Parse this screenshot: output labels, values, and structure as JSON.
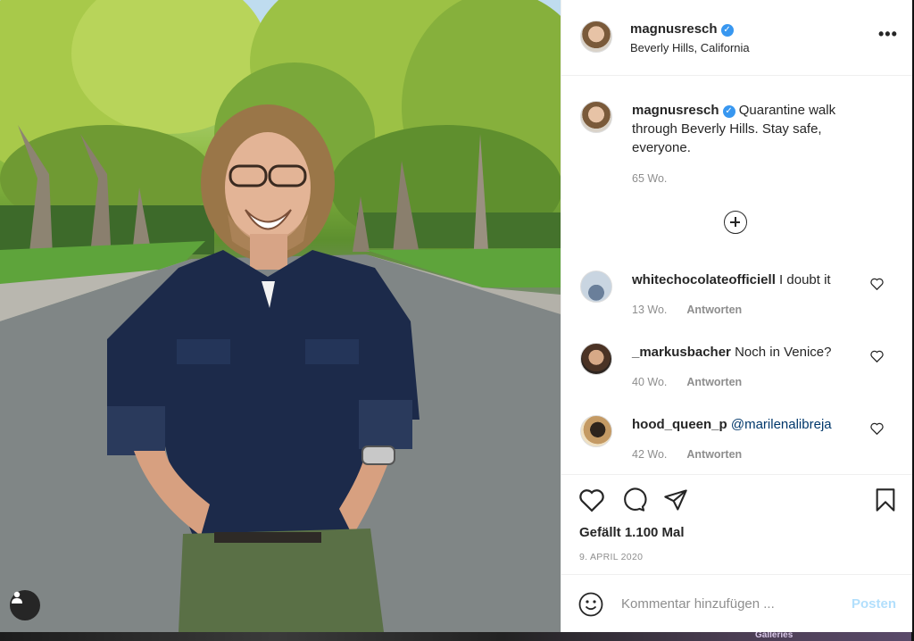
{
  "post": {
    "author": "magnusresch",
    "verified": true,
    "location": "Beverly Hills, California",
    "more_label": "•••",
    "caption": "Quarantine walk through Beverly Hills. Stay safe, everyone.",
    "caption_time": "65 Wo.",
    "likes": "Gefällt 1.100 Mal",
    "date": "9. APRIL 2020"
  },
  "comments": [
    {
      "user": "whitechocolateofficiell",
      "text": "I doubt it",
      "time": "13 Wo.",
      "reply_label": "Antworten"
    },
    {
      "user": "_markusbacher",
      "text": "Noch in Venice?",
      "time": "40 Wo.",
      "reply_label": "Antworten"
    },
    {
      "user": "hood_queen_p",
      "text": "@marilenalibreja",
      "time": "42 Wo.",
      "reply_label": "Antworten"
    }
  ],
  "composer": {
    "placeholder": "Kommentar hinzufügen ...",
    "post_label": "Posten"
  },
  "footer_strip_text": "Galleries",
  "colors": {
    "accent": "#3897f0",
    "post_disabled": "#b2dffc",
    "secondary_text": "#8e8e8e",
    "mention": "#00376b"
  },
  "icons": [
    "verified-badge-icon",
    "more-options-icon",
    "add-circle-icon",
    "heart-icon",
    "comment-icon",
    "share-icon",
    "bookmark-icon",
    "emoji-icon",
    "user-tag-icon"
  ]
}
